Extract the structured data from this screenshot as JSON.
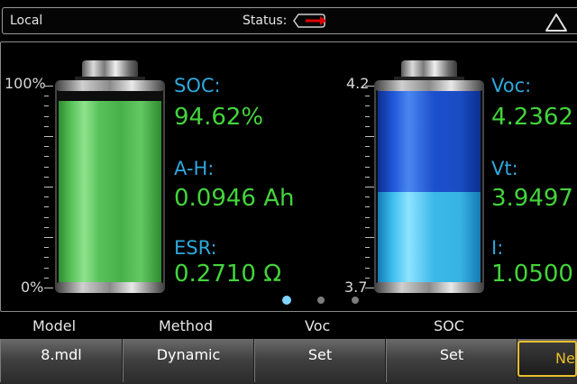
{
  "header": {
    "mode": "Local",
    "status_label": "Status:"
  },
  "soc_battery": {
    "scale_top": "100%",
    "scale_bottom": "0%",
    "fill_percent": 94.62,
    "fill_color": "#57c257",
    "soc_label": "SOC:",
    "soc_value": "94.62%",
    "ah_label": "A-H:",
    "ah_value": "0.0946 Ah",
    "esr_label": "ESR:",
    "esr_value": "0.2710 Ω"
  },
  "voltage_battery": {
    "scale_top": "4.2",
    "scale_bottom": "3.7",
    "fill_top_color": "#1f57d8",
    "fill_bottom_color": "#3fc0ee",
    "voc_label": "Voc:",
    "voc_value": "4.2362",
    "vt_label": "Vt:",
    "vt_value": "3.9497",
    "i_label": "I:",
    "i_value": "1.0500"
  },
  "pager": {
    "active_index": 0,
    "count": 3
  },
  "columns": {
    "model": "Model",
    "method": "Method",
    "voc": "Voc",
    "soc": "SOC"
  },
  "softkeys": {
    "model": "8.mdl",
    "method": "Dynamic",
    "voc_set": "Set",
    "soc_set": "Set",
    "next": "Ne"
  },
  "colors": {
    "accent_label": "#2ea8dc",
    "value_text": "#43d43b",
    "next_highlight": "#e9bf2a",
    "status_arrow": "#e00000"
  }
}
